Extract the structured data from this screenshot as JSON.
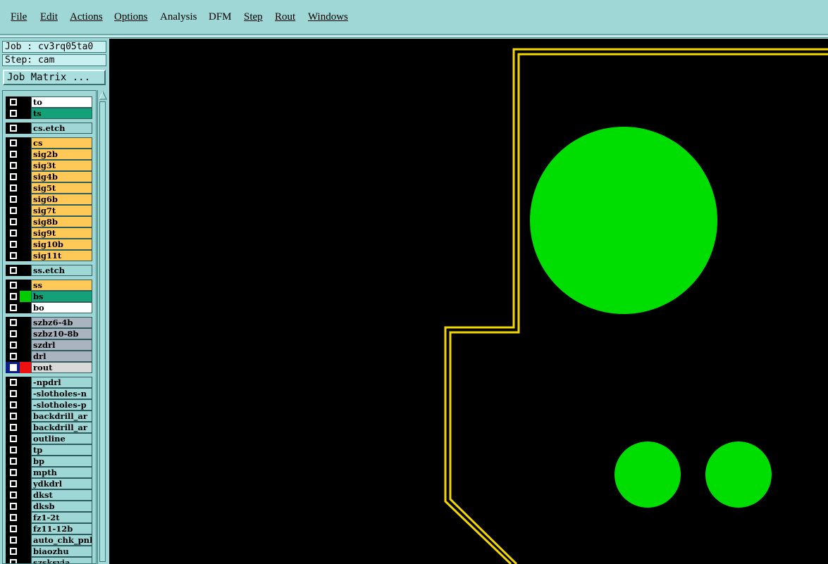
{
  "menu": {
    "items": [
      {
        "label": "File"
      },
      {
        "label": "Edit"
      },
      {
        "label": "Actions"
      },
      {
        "label": "Options"
      },
      {
        "label": "Analysis"
      },
      {
        "label": "DFM"
      },
      {
        "label": "Step"
      },
      {
        "label": "Rout"
      },
      {
        "label": "Windows"
      }
    ]
  },
  "job": {
    "line": "Job : cv3rq05ta0",
    "step_line": "Step: cam"
  },
  "job_matrix_button": "Job Matrix ...",
  "layers": [
    {
      "name": "to",
      "color": "#ffffff"
    },
    {
      "name": "ts",
      "color": "#14a078"
    },
    {
      "name": "cs.etch",
      "color": "#9fd6d6"
    },
    {
      "name": "cs",
      "color": "#ffc857"
    },
    {
      "name": "sig2b",
      "color": "#ffc857"
    },
    {
      "name": "sig3t",
      "color": "#ffc857"
    },
    {
      "name": "sig4b",
      "color": "#ffc857"
    },
    {
      "name": "sig5t",
      "color": "#ffc857"
    },
    {
      "name": "sig6b",
      "color": "#ffc857"
    },
    {
      "name": "sig7t",
      "color": "#ffc857"
    },
    {
      "name": "sig8b",
      "color": "#ffc857"
    },
    {
      "name": "sig9t",
      "color": "#ffc857"
    },
    {
      "name": "sig10b",
      "color": "#ffc857"
    },
    {
      "name": "sig11t",
      "color": "#ffc857"
    },
    {
      "name": "ss.etch",
      "color": "#9fd6d6"
    },
    {
      "name": "ss",
      "color": "#ffc857"
    },
    {
      "name": "bs",
      "color": "#14a078",
      "swatch": "#00cc00"
    },
    {
      "name": "bo",
      "color": "#ffffff"
    },
    {
      "name": "szbz6-4b",
      "color": "#a9b4c0"
    },
    {
      "name": "szbz10-8b",
      "color": "#a9b4c0"
    },
    {
      "name": "szdrl",
      "color": "#a9b4c0"
    },
    {
      "name": "drl",
      "color": "#a9b4c0"
    },
    {
      "name": "rout",
      "color": "#d9d9d9",
      "swatch": "#ee1111",
      "selected": true
    },
    {
      "name": "-npdrl",
      "color": "#9fd6d6"
    },
    {
      "name": "-slotholes-n",
      "color": "#9fd6d6"
    },
    {
      "name": "-slotholes-p",
      "color": "#9fd6d6"
    },
    {
      "name": "backdrill_ar",
      "color": "#9fd6d6"
    },
    {
      "name": "backdrill_ar",
      "color": "#9fd6d6"
    },
    {
      "name": "outline",
      "color": "#9fd6d6"
    },
    {
      "name": "tp",
      "color": "#9fd6d6"
    },
    {
      "name": "bp",
      "color": "#9fd6d6"
    },
    {
      "name": "mpth",
      "color": "#9fd6d6"
    },
    {
      "name": "ydkdrl",
      "color": "#9fd6d6"
    },
    {
      "name": "dkst",
      "color": "#9fd6d6"
    },
    {
      "name": "dksb",
      "color": "#9fd6d6"
    },
    {
      "name": "fz1-2t",
      "color": "#9fd6d6"
    },
    {
      "name": "fz11-12b",
      "color": "#9fd6d6"
    },
    {
      "name": "auto_chk_pnl",
      "color": "#9fd6d6"
    },
    {
      "name": "biaozhu",
      "color": "#9fd6d6"
    },
    {
      "name": "szsksvia",
      "color": "#9fd6d6"
    }
  ],
  "colors": {
    "outline": "#f2d600",
    "pads": "#00dd00",
    "background": "#000000",
    "panel": "#9fd6d6"
  }
}
